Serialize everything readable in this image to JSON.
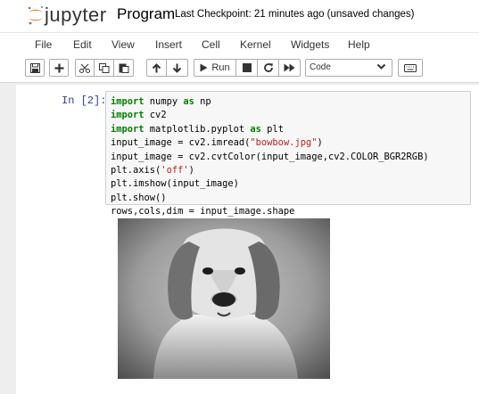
{
  "header": {
    "logo_text": "jupyter",
    "notebook_title": "Program",
    "checkpoint": "Last Checkpoint: 21 minutes ago  (unsaved changes)"
  },
  "menu": [
    {
      "label": "File"
    },
    {
      "label": "Edit"
    },
    {
      "label": "View"
    },
    {
      "label": "Insert"
    },
    {
      "label": "Cell"
    },
    {
      "label": "Kernel"
    },
    {
      "label": "Widgets"
    },
    {
      "label": "Help"
    }
  ],
  "toolbar": {
    "run_label": "Run",
    "cell_type": "Code",
    "icons": [
      "save-icon",
      "plus-icon",
      "cut-icon",
      "copy-icon",
      "paste-icon",
      "arrow-up-icon",
      "arrow-down-icon",
      "play-icon",
      "stop-icon",
      "restart-icon",
      "fast-forward-icon",
      "keyboard-icon"
    ]
  },
  "cell": {
    "prompt": "In [2]:",
    "code": [
      [
        {
          "t": "import",
          "c": "kw"
        },
        {
          "t": " numpy "
        },
        {
          "t": "as",
          "c": "kw"
        },
        {
          "t": " np"
        }
      ],
      [
        {
          "t": "import",
          "c": "kw"
        },
        {
          "t": " cv2"
        }
      ],
      [
        {
          "t": "import",
          "c": "kw"
        },
        {
          "t": " matplotlib.pyplot "
        },
        {
          "t": "as",
          "c": "kw"
        },
        {
          "t": " plt"
        }
      ],
      [
        {
          "t": "input_image = cv2.imread("
        },
        {
          "t": "\"bowbow.jpg\"",
          "c": "st"
        },
        {
          "t": ")"
        }
      ],
      [
        {
          "t": "input_image = cv2.cvtColor(input_image,cv2.COLOR_BGR2RGB)"
        }
      ],
      [
        {
          "t": "plt.axis("
        },
        {
          "t": "'off'",
          "c": "st"
        },
        {
          "t": ")"
        }
      ],
      [
        {
          "t": "plt.imshow(input_image)"
        }
      ],
      [
        {
          "t": "plt.show()"
        }
      ],
      [
        {
          "t": "rows,cols,dim = input_image.shape"
        }
      ]
    ]
  },
  "output": {
    "image": "grayscale-dog-portrait"
  },
  "colors": {
    "prompt": "#303f9f",
    "keyword": "#008000",
    "string": "#ba2121",
    "logo_orange": "#f37726"
  }
}
